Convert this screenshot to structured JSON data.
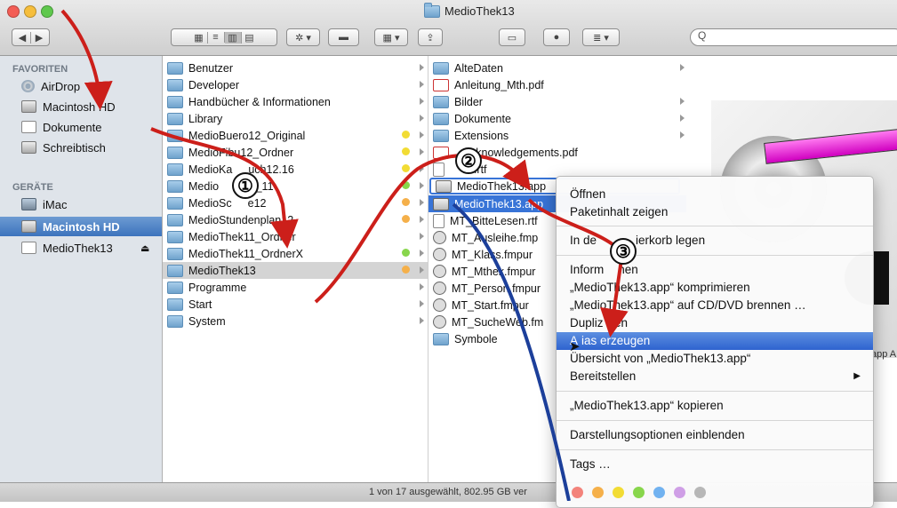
{
  "window": {
    "title": "MedioThek13"
  },
  "toolbar": {
    "search_placeholder": "Q"
  },
  "sidebar": {
    "favorites_header": "FAVORITEN",
    "favorites": [
      "AirDrop",
      "Macintosh HD",
      "Dokumente",
      "Schreibtisch"
    ],
    "devices_header": "GERÄTE",
    "devices": [
      "iMac",
      "Macintosh HD",
      "MedioThek13"
    ]
  },
  "column1": {
    "items": [
      "Benutzer",
      "Developer",
      "Handbücher & Informationen",
      "Library",
      "MedioBuero12_Original",
      "MedioFibu12_Ordner",
      "MedioKassenbuch12.16",
      "MedioPersonal_11",
      "MedioSchule12",
      "MedioStundenplan12",
      "MedioThek11_Ordner",
      "MedioThek11_OrdnerX",
      "MedioThek13",
      "Programme",
      "Start",
      "System"
    ],
    "visible_labels": [
      "Benutzer",
      "Developer",
      "Handbücher & Informationen",
      "Library",
      "MedioBuero12_Original",
      "MedioFibu12_Ordner",
      "MedioKa",
      "uch12.16",
      "Medio",
      "ll_11",
      "MedioSc",
      "e12",
      "MedioStundenplan12",
      "MedioThek11_Ordner",
      "MedioThek11_OrdnerX",
      "MedioThek13",
      "Programme",
      "Start",
      "System"
    ]
  },
  "column2": {
    "items": [
      "AlteDaten",
      "Anleitung_Mth.pdf",
      "Bilder",
      "Dokumente",
      "Extensions",
      "cknowledgements.pdf",
      "2.rtf",
      "MedioThek13.app",
      "MedioThek13.app",
      "MT_BitteLesen.rtf",
      "MT_Ausleihe.fmp",
      "MT_Klass.fmpur",
      "MT_Mthek.fmpur",
      "MT_Person.fmpur",
      "MT_Start.fmpur",
      "MT_SucheWeb.fm",
      "Symbole"
    ]
  },
  "context_menu": {
    "items": [
      "Öffnen",
      "Paketinhalt zeigen",
      "In den Papierkorb legen",
      "Informationen",
      "„MedioThek13.app“ komprimieren",
      "„MedioThek13.app“ auf CD/DVD brennen …",
      "Duplizieren",
      "Alias erzeugen",
      "Übersicht von „MedioThek13.app“",
      "Bereitstellen",
      "„MedioThek13.app“ kopieren",
      "Darstellungsoptionen einblenden",
      "Tags …"
    ],
    "visible": [
      "Öffnen",
      "Paketinhalt zeigen",
      "In de",
      "ierkorb legen",
      "Inform",
      "nen",
      "„MedioThek13.app“ komprimieren",
      "„MedioThek13.app“ auf CD/DVD brennen …",
      "Dupliz",
      "ren",
      "A",
      "ias erzeugen",
      "Übersicht von „MedioThek13.app“",
      "Bereitstellen",
      "„MedioThek13.app“ kopieren",
      "Darstellungsoptionen einblenden",
      "Tags …"
    ],
    "submenu_arrow": "▶",
    "highlighted": "Alias erzeugen",
    "tag_colors": [
      "#f3837b",
      "#f5b04a",
      "#f2dc34",
      "#88d64c",
      "#71b2f0",
      "#cf9fe6",
      "#b7b7b7"
    ]
  },
  "preview": {
    "kind_label": "app A"
  },
  "status": {
    "text": "1 von 17 ausgewählt, 802.95 GB ver"
  },
  "callouts": [
    "①",
    "②",
    "③"
  ],
  "colors": {
    "accent_blue": "#3874d7",
    "arrow_red": "#cc1f1a",
    "arrow_blue": "#1c3f9a",
    "tag_yellow": "#f2dc34",
    "tag_orange": "#f5b04a",
    "tag_green": "#88d64c"
  }
}
